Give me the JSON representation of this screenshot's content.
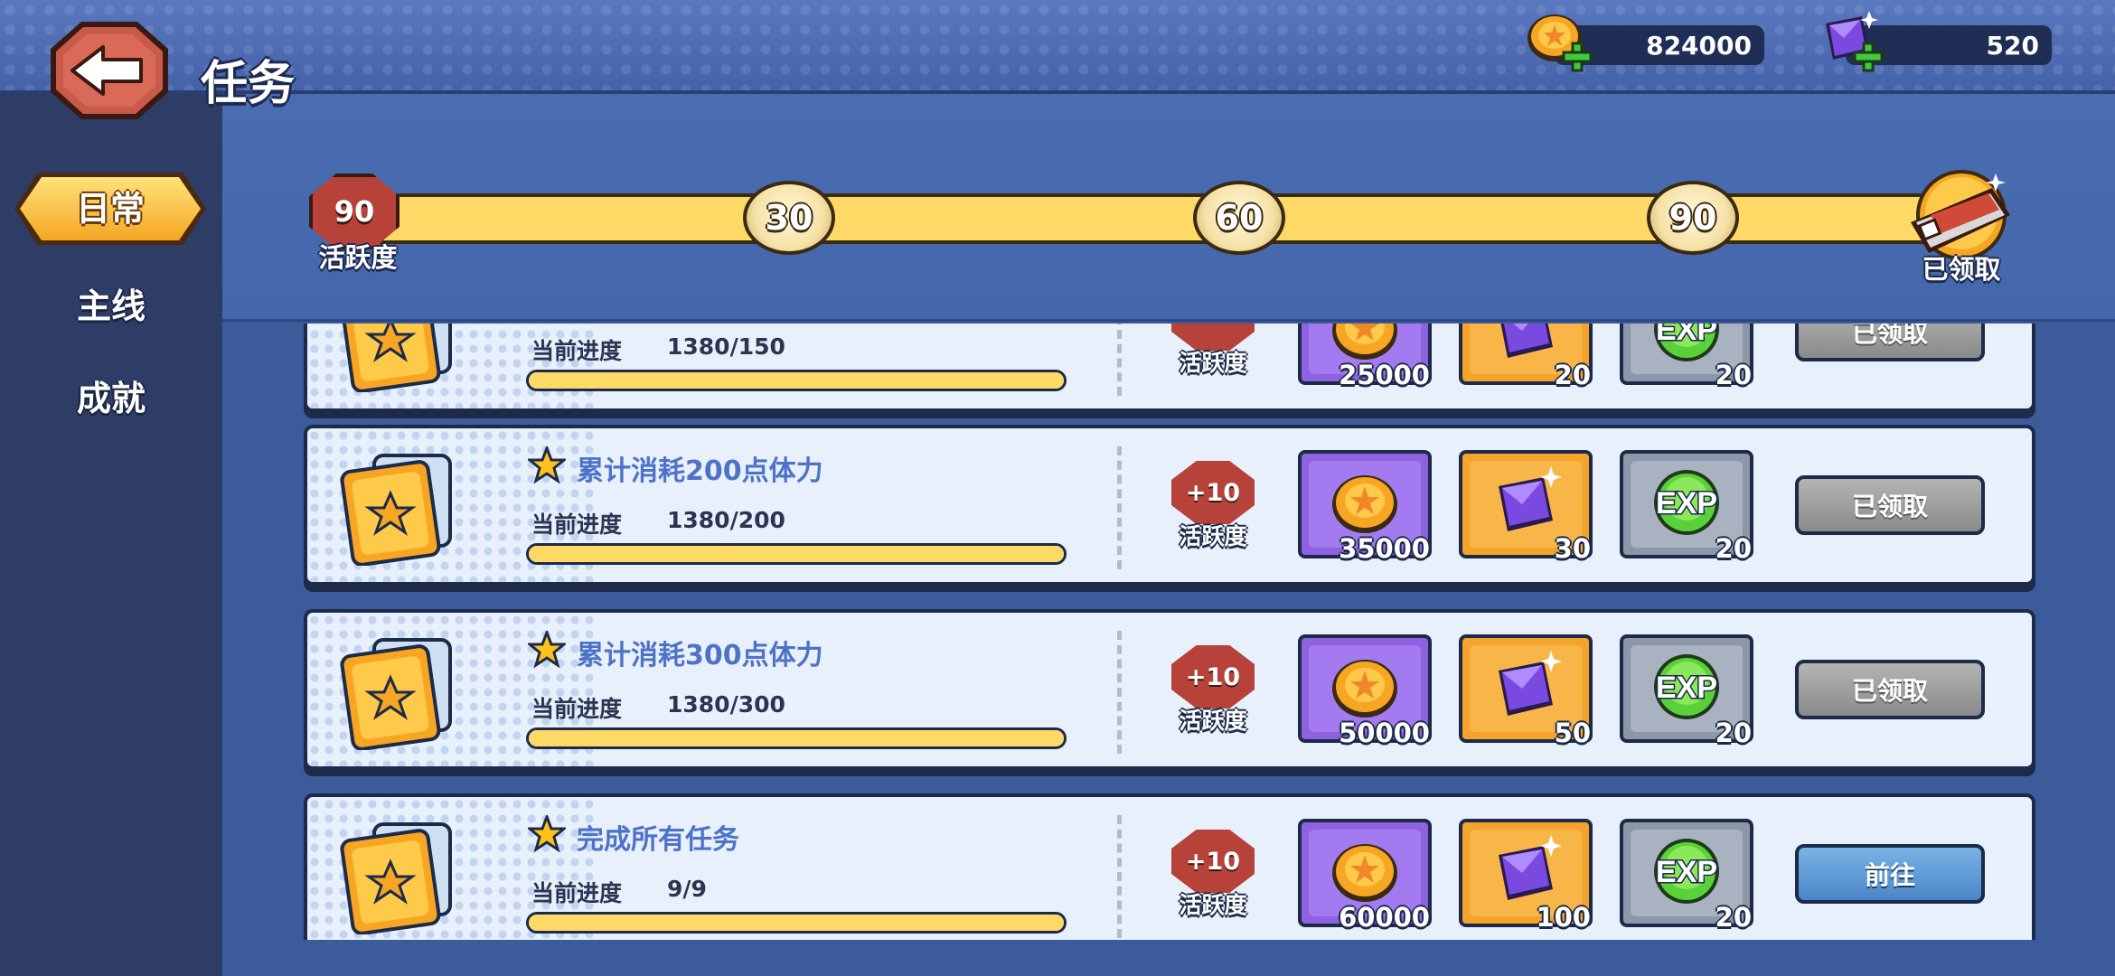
{
  "header": {
    "title": "任务",
    "coins": "824000",
    "gems": "520"
  },
  "sidebar": {
    "tabs": [
      {
        "label": "日常",
        "active": true
      },
      {
        "label": "主线",
        "active": false
      },
      {
        "label": "成就",
        "active": false
      }
    ]
  },
  "activity": {
    "current": "90",
    "label": "活跃度",
    "milestones": [
      "30",
      "60",
      "90"
    ],
    "chest_status": "已领取"
  },
  "tasks": [
    {
      "title": "",
      "progress_label": "当前进度",
      "progress_value": "1380/150",
      "progress_fraction": 1.0,
      "points": "",
      "points_label": "活跃度",
      "rewards": {
        "coins": "25000",
        "gems": "20",
        "exp": "20"
      },
      "button": "已领取",
      "state": "done"
    },
    {
      "title": "累计消耗200点体力",
      "progress_label": "当前进度",
      "progress_value": "1380/200",
      "progress_fraction": 1.0,
      "points": "+10",
      "points_label": "活跃度",
      "rewards": {
        "coins": "35000",
        "gems": "30",
        "exp": "20"
      },
      "button": "已领取",
      "state": "done"
    },
    {
      "title": "累计消耗300点体力",
      "progress_label": "当前进度",
      "progress_value": "1380/300",
      "progress_fraction": 1.0,
      "points": "+10",
      "points_label": "活跃度",
      "rewards": {
        "coins": "50000",
        "gems": "50",
        "exp": "20"
      },
      "button": "已领取",
      "state": "done"
    },
    {
      "title": "完成所有任务",
      "progress_label": "当前进度",
      "progress_value": "9/9",
      "progress_fraction": 1.0,
      "points": "+10",
      "points_label": "活跃度",
      "rewards": {
        "coins": "60000",
        "gems": "100",
        "exp": "20"
      },
      "button": "前往",
      "state": "go"
    }
  ],
  "icons": {
    "back": "back-arrow-icon",
    "coin": "coin-icon",
    "gem": "gem-icon",
    "exp": "exp-icon",
    "chest": "chest-icon",
    "task": "task-card-icon",
    "star": "star-icon"
  },
  "colors": {
    "accent_yellow": "#ffd966",
    "title_blue": "#4d72c8",
    "badge_red": "#b6423a",
    "claimed_gray": "#8a8a8a",
    "go_blue": "#4a86c6"
  }
}
